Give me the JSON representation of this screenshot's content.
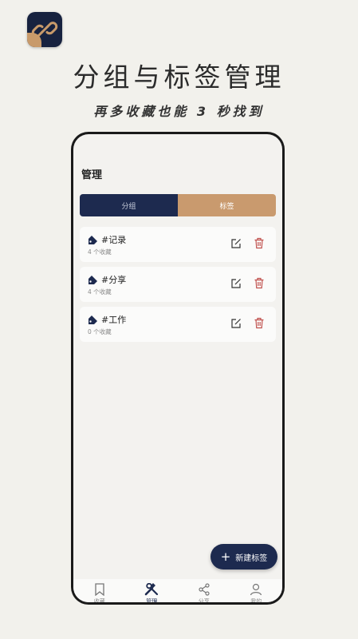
{
  "promo": {
    "title": "分组与标签管理",
    "subtitle": "再多收藏也能 3 秒找到"
  },
  "screen": {
    "page_title": "管理",
    "segments": [
      "分组",
      "标签"
    ],
    "active_segment": "标签",
    "tags": [
      {
        "name": "#记录",
        "count": "4 个收藏"
      },
      {
        "name": "#分享",
        "count": "4 个收藏"
      },
      {
        "name": "#工作",
        "count": "0 个收藏"
      }
    ],
    "fab": {
      "icon": "plus-icon",
      "label": "新建标签"
    },
    "tabbar": [
      {
        "label": "收藏",
        "icon": "bookmark-icon"
      },
      {
        "label": "管理",
        "icon": "tools-icon"
      },
      {
        "label": "分享",
        "icon": "share-icon"
      },
      {
        "label": "我的",
        "icon": "user-icon"
      }
    ],
    "active_tab": "管理"
  },
  "colors": {
    "navy": "#1d2a4f",
    "tan": "#c99a6e",
    "delete_red": "#c0504d",
    "background": "#f2f1ec"
  }
}
